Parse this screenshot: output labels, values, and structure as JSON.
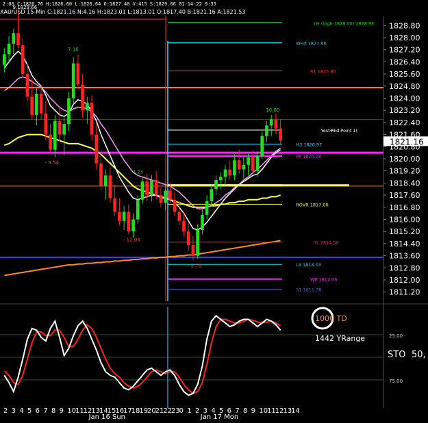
{
  "header": {
    "text": "2:00 C:1826.76 H:1826.60 L:1826.64 O:1827.40 V:415 S:1829.66 01-14-22 9:35",
    "symbol_text": "XAU/USD 15-Min C:1821.16 N:4.16 H:1823.01 L:1813.01 O:1817.40 B:1821.16 A:1821.53"
  },
  "colors": {
    "bull": "#22dd22",
    "bear": "#ff2222",
    "ema_white": "#ffffff",
    "ema_pink": "#ff99ff",
    "ema_yellow": "#ffff44",
    "ema_orange": "#ff8822",
    "pivot": "#ff3333",
    "magenta": "#ff22ff",
    "cyan": "#22ddff",
    "sto_k": "#ffffff",
    "sto_d": "#ff2222"
  },
  "chart_data": {
    "type": "candlestick",
    "ylim": [
      1810.6,
      1829.4
    ],
    "y_ticks": [
      "1828.80",
      "1828.00",
      "1827.20",
      "1826.40",
      "1825.60",
      "1824.80",
      "1824.00",
      "1823.20",
      "1822.40",
      "1821.60",
      "1820.80",
      "1820.00",
      "1819.20",
      "1818.40",
      "1817.60",
      "1816.80",
      "1816.00",
      "1815.20",
      "1814.40",
      "1813.60",
      "1812.80",
      "1812.00",
      "1811.20"
    ],
    "last_price": "1821.16",
    "x_ticks": [
      "2",
      "3",
      "4",
      "5",
      "6",
      "7",
      "8",
      "9",
      "10",
      "11",
      "12",
      "13",
      "14",
      "15",
      "16",
      "17",
      "18",
      "19",
      "20",
      "21",
      "22",
      "23",
      "0",
      "1",
      "2",
      "3",
      "4",
      "5",
      "6",
      "7",
      "8",
      "9",
      "10",
      "11",
      "12",
      "13",
      "14"
    ],
    "date_labels": [
      "Jan 16 Sun",
      "Jan 17 Mon"
    ],
    "candles": [
      {
        "o": 1826.2,
        "h": 1827.3,
        "l": 1825.7,
        "c": 1826.9
      },
      {
        "o": 1826.9,
        "h": 1828.1,
        "l": 1826.3,
        "c": 1827.6
      },
      {
        "o": 1827.6,
        "h": 1828.6,
        "l": 1826.9,
        "c": 1828.3
      },
      {
        "o": 1828.3,
        "h": 1829.7,
        "l": 1827.3,
        "c": 1827.5
      },
      {
        "o": 1827.5,
        "h": 1827.9,
        "l": 1825.4,
        "c": 1825.6
      },
      {
        "o": 1825.6,
        "h": 1826.3,
        "l": 1823.8,
        "c": 1824.1
      },
      {
        "o": 1824.1,
        "h": 1825.3,
        "l": 1822.6,
        "c": 1822.9
      },
      {
        "o": 1822.9,
        "h": 1824.7,
        "l": 1822.2,
        "c": 1824.3
      },
      {
        "o": 1824.3,
        "h": 1824.9,
        "l": 1822.6,
        "c": 1823.0
      },
      {
        "o": 1823.0,
        "h": 1823.8,
        "l": 1821.2,
        "c": 1821.6
      },
      {
        "o": 1821.6,
        "h": 1822.3,
        "l": 1820.3,
        "c": 1820.6
      },
      {
        "o": 1820.6,
        "h": 1822.9,
        "l": 1820.1,
        "c": 1822.5
      },
      {
        "o": 1822.5,
        "h": 1823.4,
        "l": 1821.1,
        "c": 1821.6
      },
      {
        "o": 1821.6,
        "h": 1822.8,
        "l": 1820.2,
        "c": 1822.3
      },
      {
        "o": 1822.3,
        "h": 1824.4,
        "l": 1821.8,
        "c": 1824.0
      },
      {
        "o": 1824.0,
        "h": 1826.7,
        "l": 1823.6,
        "c": 1826.3
      },
      {
        "o": 1826.3,
        "h": 1826.9,
        "l": 1824.6,
        "c": 1824.9
      },
      {
        "o": 1824.9,
        "h": 1825.6,
        "l": 1822.7,
        "c": 1823.2
      },
      {
        "o": 1823.2,
        "h": 1824.1,
        "l": 1822.3,
        "c": 1823.7
      },
      {
        "o": 1823.7,
        "h": 1824.2,
        "l": 1821.2,
        "c": 1821.6
      },
      {
        "o": 1821.6,
        "h": 1822.4,
        "l": 1819.3,
        "c": 1819.7
      },
      {
        "o": 1819.7,
        "h": 1820.6,
        "l": 1817.9,
        "c": 1818.2
      },
      {
        "o": 1818.2,
        "h": 1819.3,
        "l": 1817.3,
        "c": 1818.9
      },
      {
        "o": 1818.9,
        "h": 1819.4,
        "l": 1817.1,
        "c": 1817.4
      },
      {
        "o": 1817.4,
        "h": 1818.3,
        "l": 1816.2,
        "c": 1816.5
      },
      {
        "o": 1816.5,
        "h": 1817.4,
        "l": 1815.6,
        "c": 1815.9
      },
      {
        "o": 1815.9,
        "h": 1816.9,
        "l": 1815.3,
        "c": 1816.5
      },
      {
        "o": 1816.5,
        "h": 1817.0,
        "l": 1815.0,
        "c": 1815.2
      },
      {
        "o": 1815.2,
        "h": 1816.4,
        "l": 1814.8,
        "c": 1816.0
      },
      {
        "o": 1816.0,
        "h": 1817.6,
        "l": 1815.7,
        "c": 1817.3
      },
      {
        "o": 1817.3,
        "h": 1818.8,
        "l": 1817.0,
        "c": 1818.5
      },
      {
        "o": 1818.5,
        "h": 1819.0,
        "l": 1817.2,
        "c": 1817.6
      },
      {
        "o": 1817.6,
        "h": 1818.9,
        "l": 1817.2,
        "c": 1818.6
      },
      {
        "o": 1818.6,
        "h": 1819.2,
        "l": 1817.3,
        "c": 1817.6
      },
      {
        "o": 1817.6,
        "h": 1818.1,
        "l": 1816.8,
        "c": 1817.1
      },
      {
        "o": 1817.1,
        "h": 1818.3,
        "l": 1816.6,
        "c": 1817.9
      },
      {
        "o": 1817.9,
        "h": 1818.4,
        "l": 1817.1,
        "c": 1817.3
      },
      {
        "o": 1817.3,
        "h": 1817.8,
        "l": 1816.2,
        "c": 1816.5
      },
      {
        "o": 1816.5,
        "h": 1817.2,
        "l": 1815.6,
        "c": 1815.9
      },
      {
        "o": 1815.9,
        "h": 1816.5,
        "l": 1814.9,
        "c": 1815.2
      },
      {
        "o": 1815.2,
        "h": 1815.8,
        "l": 1813.9,
        "c": 1814.3
      },
      {
        "o": 1814.3,
        "h": 1814.9,
        "l": 1813.3,
        "c": 1813.6
      },
      {
        "o": 1813.6,
        "h": 1815.7,
        "l": 1813.4,
        "c": 1815.3
      },
      {
        "o": 1815.3,
        "h": 1816.7,
        "l": 1815.0,
        "c": 1816.3
      },
      {
        "o": 1816.3,
        "h": 1817.6,
        "l": 1816.0,
        "c": 1817.2
      },
      {
        "o": 1817.2,
        "h": 1818.3,
        "l": 1816.9,
        "c": 1818.0
      },
      {
        "o": 1818.0,
        "h": 1818.9,
        "l": 1817.6,
        "c": 1818.6
      },
      {
        "o": 1818.6,
        "h": 1819.1,
        "l": 1818.0,
        "c": 1818.8
      },
      {
        "o": 1818.8,
        "h": 1819.6,
        "l": 1818.3,
        "c": 1819.3
      },
      {
        "o": 1819.3,
        "h": 1819.9,
        "l": 1818.6,
        "c": 1818.9
      },
      {
        "o": 1818.9,
        "h": 1820.3,
        "l": 1818.6,
        "c": 1819.9
      },
      {
        "o": 1819.9,
        "h": 1820.6,
        "l": 1819.0,
        "c": 1819.3
      },
      {
        "o": 1819.3,
        "h": 1820.1,
        "l": 1818.7,
        "c": 1819.6
      },
      {
        "o": 1819.6,
        "h": 1820.4,
        "l": 1818.9,
        "c": 1820.1
      },
      {
        "o": 1820.1,
        "h": 1820.6,
        "l": 1818.9,
        "c": 1819.2
      },
      {
        "o": 1819.2,
        "h": 1820.5,
        "l": 1818.8,
        "c": 1820.2
      },
      {
        "o": 1820.2,
        "h": 1821.8,
        "l": 1820.0,
        "c": 1821.5
      },
      {
        "o": 1821.5,
        "h": 1822.5,
        "l": 1821.1,
        "c": 1822.2
      },
      {
        "o": 1822.2,
        "h": 1822.9,
        "l": 1821.5,
        "c": 1822.6
      },
      {
        "o": 1822.6,
        "h": 1823.0,
        "l": 1821.6,
        "c": 1822.0
      },
      {
        "o": 1822.0,
        "h": 1822.6,
        "l": 1820.9,
        "c": 1821.2
      }
    ],
    "first_date_candle": 21,
    "second_date_candle": 42,
    "session_start_candle": 36,
    "extremes": [
      {
        "label": "9.1829.66",
        "candle": 3,
        "price": 1829.66,
        "pos": "above",
        "color": "#ffffff"
      },
      {
        "label": "7.16",
        "candle": 15,
        "price": 1826.9,
        "pos": "above",
        "color": "#22dd22"
      },
      {
        "label": "- 9.54",
        "candle": 10,
        "price": 1820.1,
        "pos": "below",
        "color": "#ff4444"
      },
      {
        "label": "4.23",
        "candle": 29,
        "price": 1818.8,
        "pos": "above",
        "color": "#22dd22"
      },
      {
        "label": "- 12.04",
        "candle": 27,
        "price": 1815.0,
        "pos": "below",
        "color": "#ff4444"
      },
      {
        "label": "- 5.78",
        "candle": 41,
        "price": 1813.3,
        "pos": "below",
        "color": "#ff4444"
      },
      {
        "label": "10.00",
        "candle": 58,
        "price": 1822.9,
        "pos": "above",
        "color": "#22dd22"
      }
    ],
    "levels": [
      {
        "label": "LH (high-1828.00) 1828.98",
        "value": 1828.98,
        "color": "#22dd22",
        "from": 36,
        "text_x": 0.82,
        "width": 1.5
      },
      {
        "label": "WH3 1827.66",
        "value": 1827.66,
        "color": "#22ddff",
        "from": 36,
        "text_x": 0.72,
        "width": 1.5
      },
      {
        "label": "R1 1825.80",
        "value": 1825.8,
        "color": "#ff3333",
        "from": 36,
        "text_x": 0.8,
        "width": 1
      },
      {
        "label": "Yest Mid Point 1(",
        "value": 1821.9,
        "color": "#ffffff",
        "from": 36,
        "text_x": 0.86,
        "width": 1
      },
      {
        "label": "H3 1820.97",
        "value": 1820.97,
        "color": "#22ddff",
        "from": 36,
        "text_x": 0.72,
        "width": 1
      },
      {
        "label": "PP 1820.18",
        "value": 1820.18,
        "color": "#ff22ff",
        "from": 36,
        "text_x": 0.72,
        "width": 2
      },
      {
        "label": "",
        "value": 1818.25,
        "color": "#ffff44",
        "from": 36,
        "text_x": 0.9,
        "width": 3
      },
      {
        "label": "ROVR 1817.00",
        "value": 1817.0,
        "color": "#ffff44",
        "from": 36,
        "text_x": 0.72,
        "width": 1
      },
      {
        "label": "YL 1814.50",
        "value": 1814.5,
        "color": "#ff3333",
        "from": 36,
        "text_x": 0.82,
        "width": 1
      },
      {
        "label": "L3 1813.03",
        "value": 1813.03,
        "color": "#22ddff",
        "from": 36,
        "text_x": 0.72,
        "width": 1
      },
      {
        "label": "WP 1812.06",
        "value": 1812.06,
        "color": "#ff22ff",
        "from": 36,
        "text_x": 0.8,
        "width": 2
      },
      {
        "label": "S1 1811.38",
        "value": 1811.38,
        "color": "#4466ff",
        "from": 36,
        "text_x": 0.72,
        "width": 1
      }
    ],
    "bg_levels": [
      {
        "value": 1824.7,
        "color": "#ff7722",
        "width": 2
      },
      {
        "value": 1822.6,
        "color": "#225522",
        "width": 1
      },
      {
        "value": 1820.4,
        "color": "#ff22ff",
        "width": 3
      },
      {
        "value": 1818.2,
        "color": "#ff7722",
        "width": 1
      },
      {
        "value": 1813.5,
        "color": "#4444ff",
        "width": 2
      }
    ],
    "ema_white": [
      1826.0,
      1826.4,
      1826.8,
      1827.1,
      1826.8,
      1826.2,
      1825.5,
      1825.1,
      1824.8,
      1824.2,
      1823.5,
      1823.2,
      1822.9,
      1822.8,
      1823.0,
      1823.6,
      1823.9,
      1823.8,
      1823.6,
      1823.1,
      1822.5,
      1821.6,
      1820.9,
      1820.2,
      1819.5,
      1818.8,
      1818.3,
      1817.8,
      1817.4,
      1817.3,
      1817.4,
      1817.5,
      1817.6,
      1817.6,
      1817.4,
      1817.4,
      1817.3,
      1817.1,
      1816.8,
      1816.4,
      1815.9,
      1815.4,
      1815.3,
      1815.5,
      1815.8,
      1816.2,
      1816.6,
      1817.0,
      1817.4,
      1817.7,
      1818.0,
      1818.3,
      1818.5,
      1818.7,
      1818.9,
      1819.0,
      1819.3,
      1819.7,
      1820.1,
      1820.4,
      1820.6
    ],
    "ema_pink": [
      1824.5,
      1824.7,
      1825.0,
      1825.3,
      1825.4,
      1825.3,
      1825.1,
      1824.9,
      1824.7,
      1824.4,
      1824.0,
      1823.7,
      1823.4,
      1823.2,
      1823.1,
      1823.3,
      1823.4,
      1823.4,
      1823.3,
      1823.1,
      1822.8,
      1822.3,
      1821.9,
      1821.4,
      1820.9,
      1820.4,
      1819.9,
      1819.5,
      1819.1,
      1818.9,
      1818.8,
      1818.7,
      1818.6,
      1818.5,
      1818.4,
      1818.3,
      1818.2,
      1818.0,
      1817.8,
      1817.5,
      1817.2,
      1816.9,
      1816.7,
      1816.7,
      1816.8,
      1816.9,
      1817.1,
      1817.3,
      1817.6,
      1817.8,
      1818.1,
      1818.3,
      1818.6,
      1818.8,
      1819.1,
      1819.3,
      1819.6,
      1819.9,
      1820.2,
      1820.5,
      1820.7
    ],
    "ema_yellow": [
      1820.9,
      1821.0,
      1821.2,
      1821.4,
      1821.5,
      1821.6,
      1821.6,
      1821.6,
      1821.6,
      1821.5,
      1821.4,
      1821.3,
      1821.2,
      1821.1,
      1821.0,
      1821.0,
      1821.0,
      1820.9,
      1820.8,
      1820.7,
      1820.5,
      1820.3,
      1820.0,
      1819.7,
      1819.4,
      1819.1,
      1818.8,
      1818.5,
      1818.2,
      1818.0,
      1817.9,
      1817.8,
      1817.7,
      1817.6,
      1817.5,
      1817.4,
      1817.3,
      1817.2,
      1817.1,
      1817.0,
      1816.9,
      1816.8,
      1816.8,
      1816.8,
      1816.8,
      1816.9,
      1816.9,
      1817.0,
      1817.0,
      1817.1,
      1817.1,
      1817.2,
      1817.2,
      1817.3,
      1817.3,
      1817.3,
      1817.4,
      1817.4,
      1817.5,
      1817.5,
      1817.6
    ],
    "ema_orange": [
      1812.3,
      1812.35,
      1812.4,
      1812.45,
      1812.5,
      1812.55,
      1812.6,
      1812.65,
      1812.7,
      1812.75,
      1812.8,
      1812.85,
      1812.9,
      1812.95,
      1813.0,
      1813.0,
      1813.05,
      1813.05,
      1813.1,
      1813.1,
      1813.15,
      1813.15,
      1813.2,
      1813.2,
      1813.25,
      1813.25,
      1813.3,
      1813.3,
      1813.35,
      1813.35,
      1813.4,
      1813.4,
      1813.45,
      1813.45,
      1813.5,
      1813.5,
      1813.55,
      1813.55,
      1813.6,
      1813.6,
      1813.65,
      1813.65,
      1813.7,
      1813.75,
      1813.8,
      1813.85,
      1813.9,
      1813.95,
      1814.0,
      1814.05,
      1814.1,
      1814.15,
      1814.2,
      1814.25,
      1814.3,
      1814.35,
      1814.4,
      1814.45,
      1814.5,
      1814.55,
      1814.6
    ],
    "stochastic": {
      "label": "STO",
      "value_label": "50,",
      "y_ticks": [
        "25.00",
        "75.00"
      ],
      "k": [
        30,
        22,
        12,
        28,
        48,
        70,
        82,
        80,
        72,
        68,
        82,
        90,
        72,
        52,
        60,
        74,
        85,
        90,
        82,
        70,
        58,
        44,
        34,
        30,
        28,
        22,
        16,
        14,
        18,
        24,
        30,
        36,
        38,
        34,
        30,
        34,
        36,
        30,
        20,
        12,
        8,
        10,
        20,
        40,
        70,
        90,
        96,
        92,
        88,
        84,
        86,
        90,
        92,
        92,
        88,
        84,
        88,
        92,
        90,
        86,
        80
      ],
      "d": [
        35,
        30,
        22,
        20,
        30,
        48,
        66,
        78,
        78,
        74,
        74,
        80,
        80,
        72,
        62,
        62,
        70,
        80,
        86,
        82,
        72,
        60,
        48,
        38,
        32,
        28,
        22,
        18,
        16,
        18,
        22,
        28,
        34,
        36,
        34,
        32,
        34,
        34,
        28,
        20,
        14,
        10,
        12,
        22,
        42,
        66,
        84,
        92,
        92,
        90,
        88,
        88,
        90,
        92,
        91,
        89,
        88,
        89,
        90,
        88,
        85
      ]
    }
  },
  "overlay": {
    "td_label": "1000 TD",
    "yrange_label": "1442 YRange"
  }
}
